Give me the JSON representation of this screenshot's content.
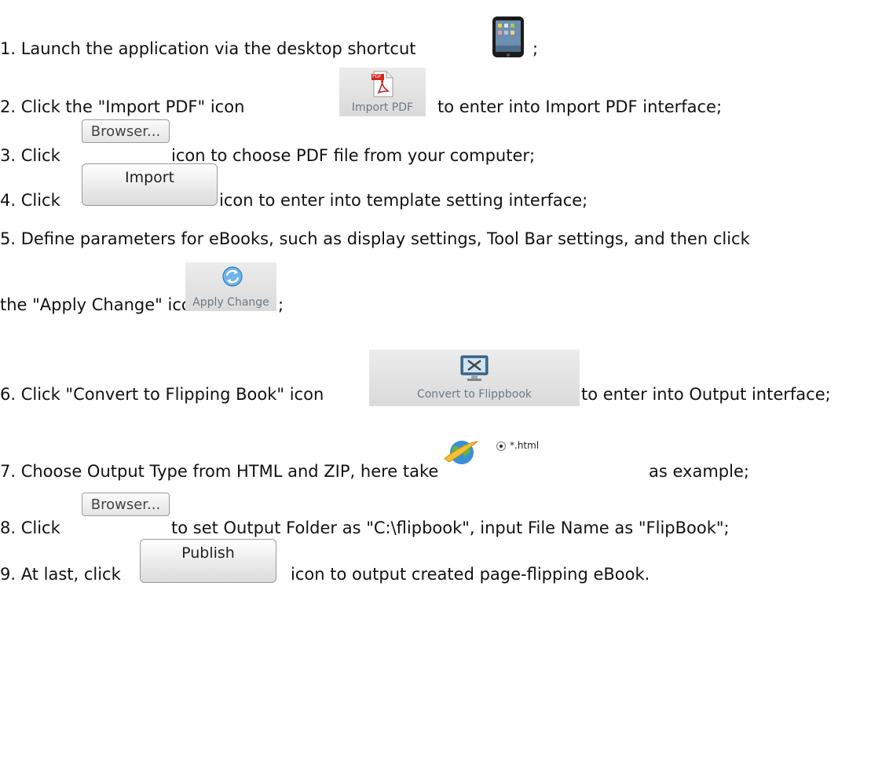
{
  "steps": [
    {
      "text": "1. Launch the application via the desktop shortcut",
      "suffix": ";"
    },
    {
      "text": "2. Click the \"Import PDF\" icon",
      "button": "Import PDF",
      "badge": "PDF",
      "suffix": "to enter into Import PDF interface;"
    },
    {
      "text": "3. Click",
      "button": "Browser...",
      "suffix": "icon to choose PDF file from your computer;"
    },
    {
      "text": "4. Click",
      "button": "Import",
      "suffix": "icon to enter into template setting interface;"
    },
    {
      "text": "5. Define parameters for eBooks, such as display settings, Tool Bar settings, and then click",
      "text2": "the \"Apply Change\" icon",
      "button": "Apply Change",
      "suffix": ";"
    },
    {
      "text": "6. Click \"Convert to Flipping Book\" icon",
      "button": "Convert to Flippbook",
      "suffix": "to enter into Output interface;"
    },
    {
      "text": "7. Choose Output Type from HTML and ZIP, here take",
      "option": "*.html",
      "suffix": "as example;"
    },
    {
      "text": "8. Click",
      "button": "Browser...",
      "suffix": "to set Output Folder as \"C:\\flipbook\", input File Name as \"FlipBook\";"
    },
    {
      "text": "9. At last, click",
      "button": "Publish",
      "suffix": "icon to output created page-flipping eBook."
    }
  ]
}
